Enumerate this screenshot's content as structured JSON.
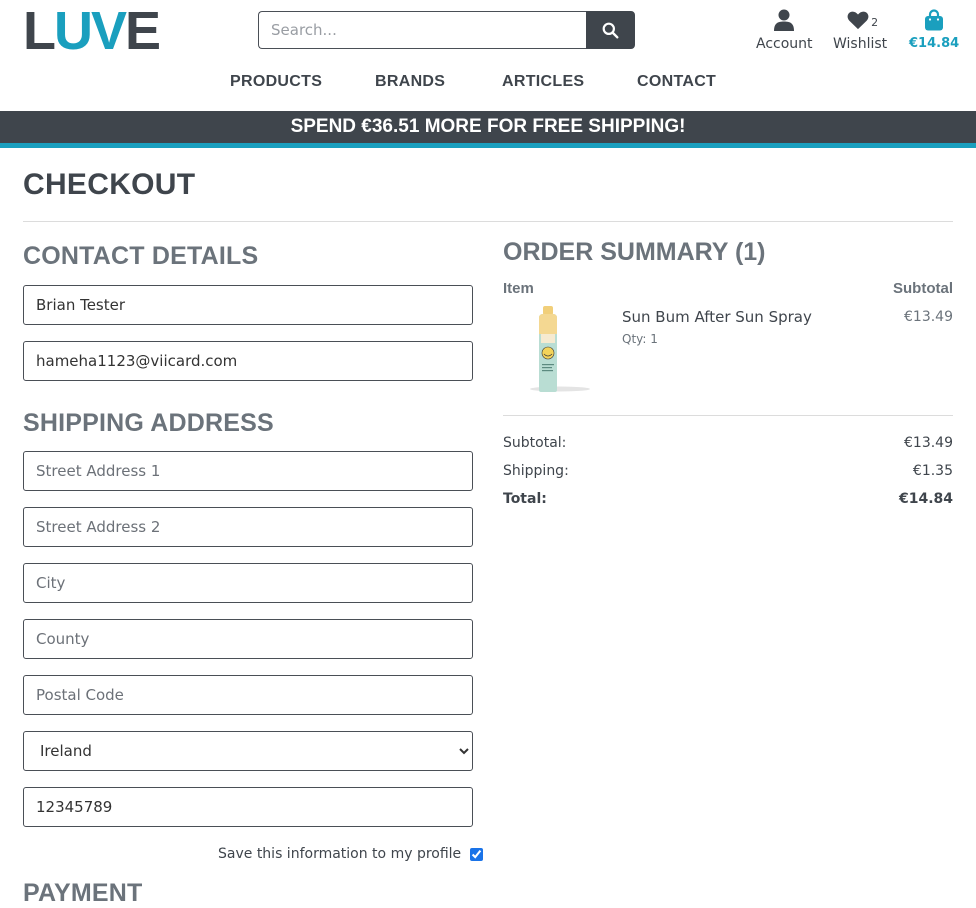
{
  "brand": {
    "logo_dark": "L",
    "logo_accent": "UV",
    "logo_dark2": "E"
  },
  "colors": {
    "accent": "#1a9fbe",
    "dark": "#3f454c",
    "muted": "#6b737b"
  },
  "search": {
    "placeholder": "Search...",
    "icon": "search-icon"
  },
  "header": {
    "account_label": "Account",
    "wishlist_label": "Wishlist",
    "wishlist_count": "2",
    "cart_total": "€14.84"
  },
  "nav": {
    "items": [
      "PRODUCTS",
      "BRANDS",
      "ARTICLES",
      "CONTACT"
    ]
  },
  "banner": {
    "text": "SPEND €36.51 MORE FOR FREE SHIPPING!"
  },
  "page": {
    "title": "CHECKOUT"
  },
  "contact": {
    "heading": "CONTACT DETAILS",
    "full_name": "Brian Tester",
    "email": "hameha1123@viicard.com"
  },
  "shipping": {
    "heading": "SHIPPING ADDRESS",
    "street1_placeholder": "Street Address 1",
    "street2_placeholder": "Street Address 2",
    "city_placeholder": "City",
    "county_placeholder": "County",
    "postal_placeholder": "Postal Code",
    "country": "Ireland",
    "phone": "12345789",
    "save_label": "Save this information to my profile"
  },
  "payment": {
    "heading": "PAYMENT"
  },
  "order": {
    "heading": "ORDER SUMMARY (1)",
    "col_item": "Item",
    "col_subtotal": "Subtotal",
    "items": [
      {
        "name": "Sun Bum After Sun Spray",
        "qty": "Qty: 1",
        "price": "€13.49"
      }
    ],
    "subtotal_label": "Subtotal:",
    "subtotal_value": "€13.49",
    "shipping_label": "Shipping:",
    "shipping_value": "€1.35",
    "total_label": "Total:",
    "total_value": "€14.84"
  }
}
